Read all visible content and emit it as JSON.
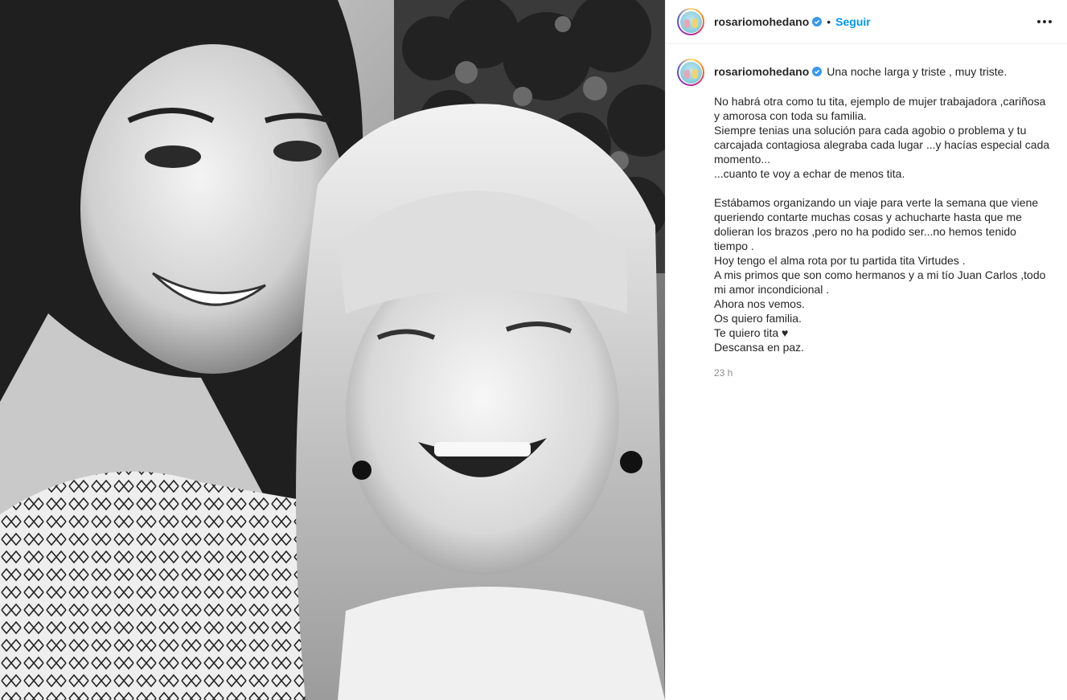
{
  "post": {
    "username": "rosariomohedano",
    "follow_label": "Seguir",
    "separator": "•",
    "accent_color": "#0095f6",
    "verified_color": "#3897f0",
    "icons": {
      "more": "more-horizontal-icon",
      "verified": "verified-badge-icon"
    }
  },
  "caption": {
    "first_line": "Una noche larga y triste , muy triste.",
    "lines": [
      "No habrá otra como tu tita, ejemplo de mujer trabajadora ,cariñosa",
      "y amorosa con toda su familia.",
      "Siempre tenias una solución para cada agobio o problema y tu",
      "carcajada contagiosa alegraba cada lugar ...y hacías especial cada",
      "momento...",
      "...cuanto te voy a echar de menos tita.",
      "",
      "Estábamos organizando un viaje para verte la semana que viene",
      "queriendo contarte muchas cosas y achucharte hasta que me",
      "dolieran los brazos ,pero no ha podido ser...no hemos tenido",
      "tiempo .",
      "Hoy tengo el alma rota por tu partida tita Virtudes .",
      "A mis primos que son como hermanos y a mi tío Juan Carlos ,todo",
      "mi amor incondicional .",
      "Ahora nos vemos.",
      "Os quiero familia.",
      "Te quiero tita ♥",
      "Descansa en paz."
    ],
    "timestamp": "23 h"
  }
}
